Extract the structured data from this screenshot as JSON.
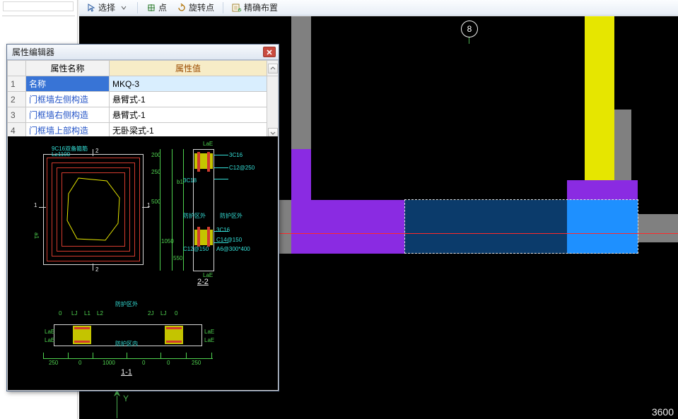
{
  "toolbar": {
    "select_label": "选择",
    "point_label": "点",
    "rotate_label": "旋转点",
    "precise_label": "精确布置"
  },
  "canvas": {
    "axis_marker": "8",
    "axis_y_label": "Y",
    "dim_right": "3600"
  },
  "property_editor": {
    "title": "属性编辑器",
    "columns": {
      "name": "属性名称",
      "value": "属性值"
    },
    "rows": [
      {
        "n": "1",
        "name": "名称",
        "value": "MKQ-3"
      },
      {
        "n": "2",
        "name": "门框墙左侧构造",
        "value": "悬臂式-1"
      },
      {
        "n": "3",
        "name": "门框墙右侧构造",
        "value": "悬臂式-1"
      },
      {
        "n": "4",
        "name": "门框墙上部构造",
        "value": "无卧梁式-1"
      }
    ]
  },
  "preview": {
    "top_bar_label": "9C16双备箍筋",
    "dist_label": "L≥1100",
    "sec_2_2": "2-2",
    "sec_1_1": "1-1",
    "shield_out": "防护区外",
    "shield_in": "防护区内",
    "dim_200": "200",
    "dim_250": "250",
    "dim_500": "500",
    "dim_1000": "1000",
    "dim_1050": "1050",
    "dim_550": "550",
    "dim_a1": "a1",
    "dim_b1": "b1",
    "dim_l1": "L1",
    "dim_l2": "L2",
    "dim_lj": "LJ",
    "dim_2j": "2J",
    "dim_laf": "LaE",
    "rebar_3c16": "3C16",
    "rebar_3c18": "3C18",
    "rebar_c12_150": "C12@150",
    "rebar_c14_150": "C14@150",
    "rebar_c12_250": "C12@250",
    "rebar_a6_300_400": "A6@300*400",
    "marker_1": "1",
    "marker_2": "2"
  }
}
